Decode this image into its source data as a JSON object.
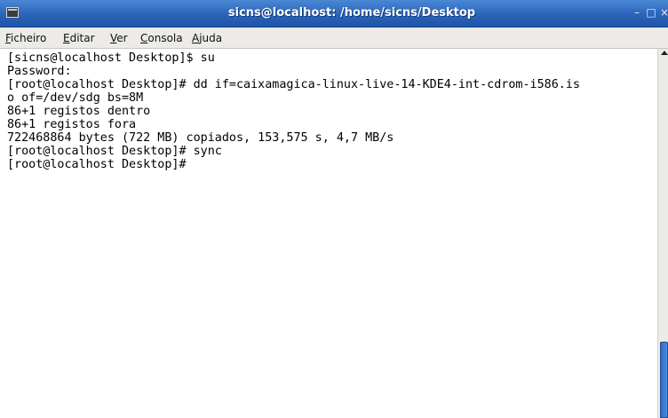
{
  "window": {
    "title": "sicns@localhost: /home/sicns/Desktop",
    "controls": {
      "minimize": "–",
      "maximize": "□",
      "close": "×"
    }
  },
  "menu": [
    {
      "pre": "",
      "acc": "F",
      "post": "icheiro"
    },
    {
      "pre": "",
      "acc": "E",
      "post": "ditar"
    },
    {
      "pre": "",
      "acc": "V",
      "post": "er"
    },
    {
      "pre": "",
      "acc": "C",
      "post": "onsola"
    },
    {
      "pre": "",
      "acc": "A",
      "post": "juda"
    }
  ],
  "terminal": {
    "lines": [
      "[sicns@localhost Desktop]$ su",
      "Password:",
      "[root@localhost Desktop]# dd if=caixamagica-linux-live-14-KDE4-int-cdrom-i586.is",
      "o of=/dev/sdg bs=8M",
      "86+1 registos dentro",
      "86+1 registos fora",
      "722468864 bytes (722 MB) copiados, 153,575 s, 4,7 MB/s",
      "[root@localhost Desktop]# sync",
      "[root@localhost Desktop]#"
    ]
  },
  "icons": {
    "window_icon": "terminal-window-icon",
    "scroll_up": "arrow-up-icon"
  },
  "colors": {
    "titlebar": "#2a63b8",
    "menubar": "#ecebe7",
    "terminal_bg": "#ffffff",
    "terminal_fg": "#000000",
    "scroll_thumb": "#3b7bd4"
  }
}
